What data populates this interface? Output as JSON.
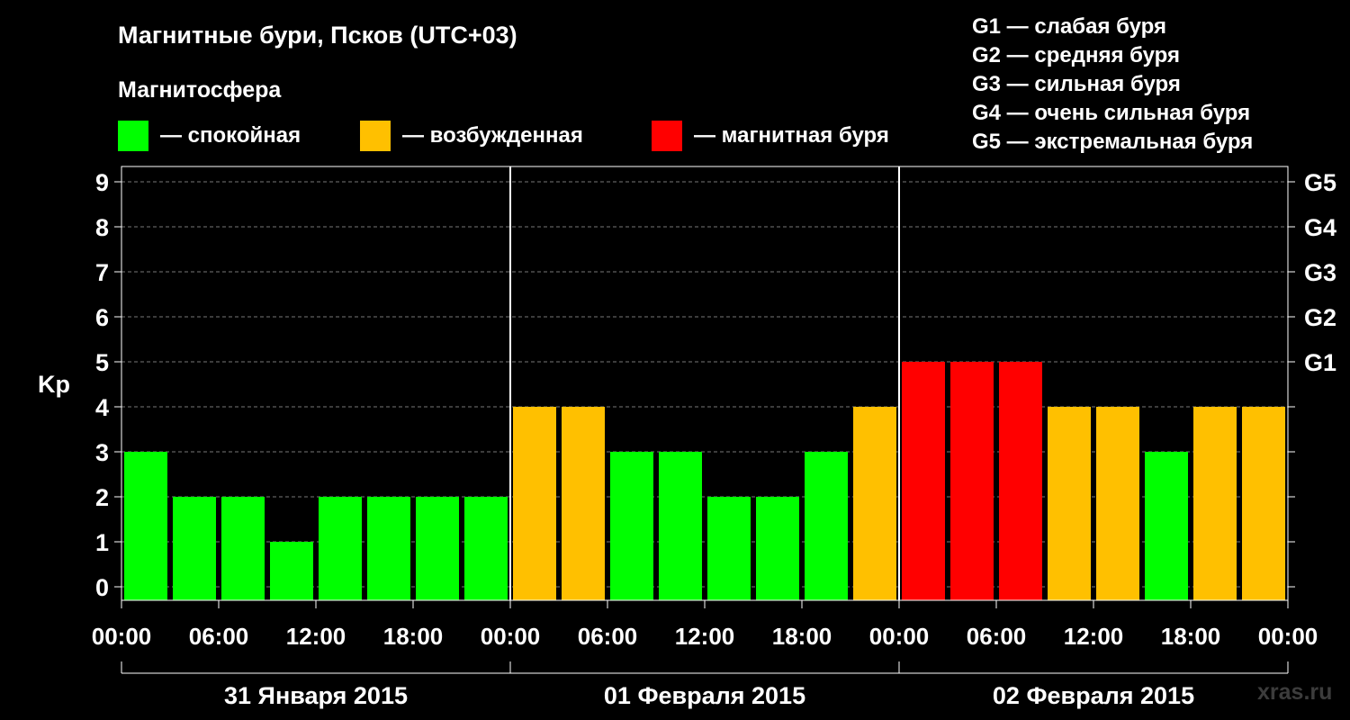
{
  "header": {
    "title": "Магнитные бури, Псков (UTC+03)",
    "subtitle": "Магнитосфера"
  },
  "legend": [
    {
      "color": "#00ff00",
      "label": "— спокойная"
    },
    {
      "color": "#ffc000",
      "label": "— возбужденная"
    },
    {
      "color": "#ff0000",
      "label": "— магнитная буря"
    }
  ],
  "g_scale": [
    "G1 — слабая буря",
    "G2 — средняя буря",
    "G3 — сильная буря",
    "G4 — очень сильная буря",
    "G5 — экстремальная буря"
  ],
  "watermark": "xras.ru",
  "chart_data": {
    "type": "bar",
    "ylabel": "Kp",
    "ylim": [
      0,
      9
    ],
    "yticks": [
      "0",
      "1",
      "2",
      "3",
      "4",
      "5",
      "6",
      "7",
      "8",
      "9"
    ],
    "right_ticks": [
      {
        "value": 5,
        "label": "G1"
      },
      {
        "value": 6,
        "label": "G2"
      },
      {
        "value": 7,
        "label": "G3"
      },
      {
        "value": 8,
        "label": "G4"
      },
      {
        "value": 9,
        "label": "G5"
      }
    ],
    "grid": true,
    "x_tick_labels": [
      "00:00",
      "06:00",
      "12:00",
      "18:00",
      "00:00",
      "06:00",
      "12:00",
      "18:00",
      "00:00",
      "06:00",
      "12:00",
      "18:00",
      "00:00"
    ],
    "days": [
      "31 Января 2015",
      "01 Февраля 2015",
      "02 Февраля 2015"
    ],
    "values": [
      3,
      2,
      2,
      1,
      2,
      2,
      2,
      2,
      4,
      4,
      3,
      3,
      2,
      2,
      3,
      4,
      5,
      5,
      5,
      4,
      4,
      3,
      4,
      4
    ],
    "colors": {
      "quiet": "#00ff00",
      "active": "#ffc000",
      "storm": "#ff0000"
    }
  }
}
